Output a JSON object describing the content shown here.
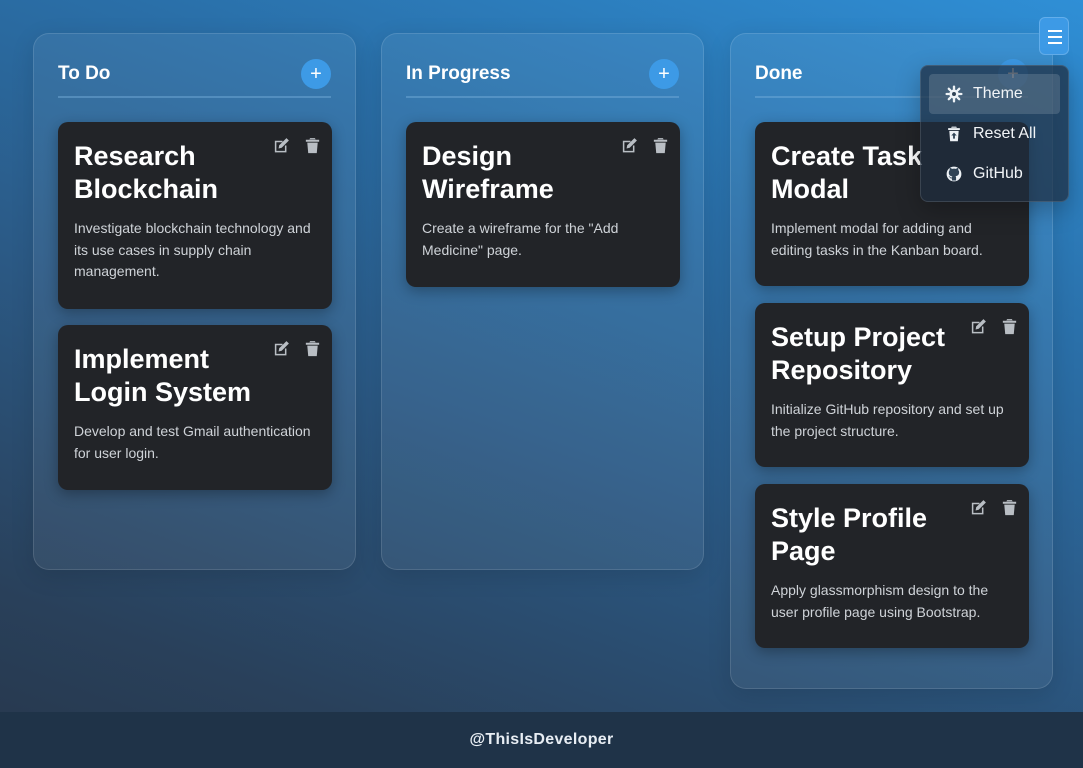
{
  "columns": [
    {
      "title": "To Do",
      "add_label": "+",
      "cards": [
        {
          "title": "Research Blockchain",
          "description": "Investigate blockchain technology and its use cases in supply chain management."
        },
        {
          "title": "Implement Login System",
          "description": "Develop and test Gmail authentication for user login."
        }
      ]
    },
    {
      "title": "In Progress",
      "add_label": "+",
      "cards": [
        {
          "title": "Design Wireframe",
          "description": "Create a wireframe for the \"Add Medicine\" page."
        }
      ]
    },
    {
      "title": "Done",
      "add_label": "+",
      "cards": [
        {
          "title": "Create Task Modal",
          "description": "Implement modal for adding and editing tasks in the Kanban board."
        },
        {
          "title": "Setup Project Repository",
          "description": "Initialize GitHub repository and set up the project structure."
        },
        {
          "title": "Style Profile Page",
          "description": "Apply glassmorphism design to the user profile page using Bootstrap."
        }
      ]
    }
  ],
  "menu": {
    "toggle_icon": "hamburger-icon",
    "items": [
      {
        "label": "Theme",
        "icon": "gear-icon"
      },
      {
        "label": "Reset All",
        "icon": "trash-arrow-icon"
      },
      {
        "label": "GitHub",
        "icon": "github-icon"
      }
    ]
  },
  "footer": {
    "text": "@ThisIsDeveloper"
  },
  "colors": {
    "accent": "#3d9ae6",
    "card": "#222428",
    "footer": "#1f3348"
  }
}
